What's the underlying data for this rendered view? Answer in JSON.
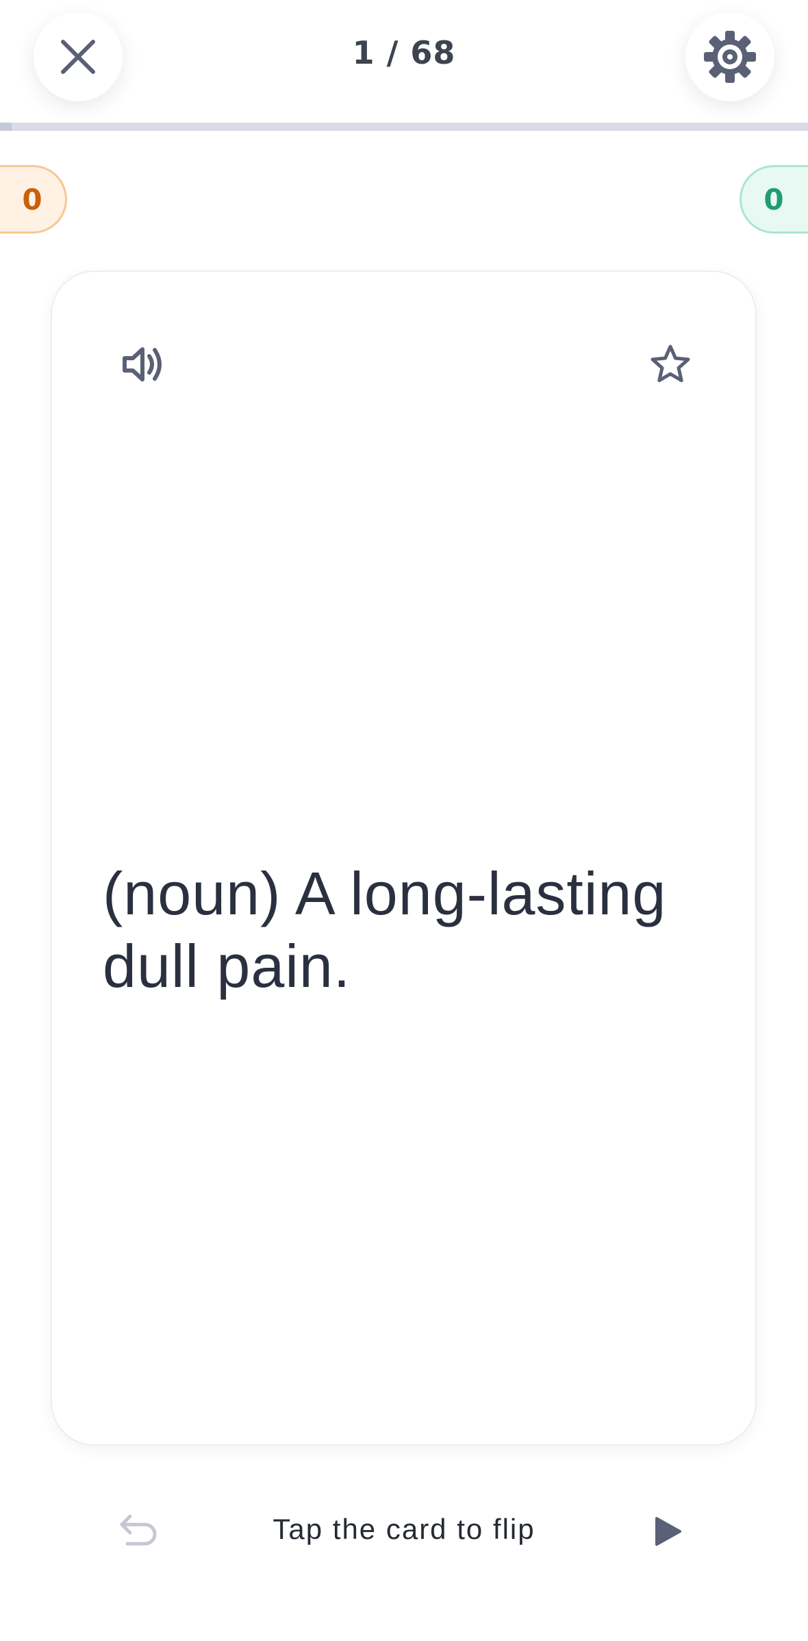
{
  "header": {
    "counter": "1 / 68",
    "close_icon": "close-icon",
    "settings_icon": "gear-icon",
    "progress": {
      "current": 1,
      "total": 68
    }
  },
  "scores": {
    "still_learning": "0",
    "known": "0"
  },
  "card": {
    "text": "(noun) A long-lasting dull pain.",
    "audio_icon": "speaker-icon",
    "star_icon": "star-icon"
  },
  "footer": {
    "hint": "Tap the card to flip",
    "undo_icon": "undo-icon",
    "play_icon": "play-icon"
  },
  "colors": {
    "icon": "#5a6075",
    "text": "#2b3040",
    "learning": "#c8600b",
    "known": "#1e9d72"
  }
}
